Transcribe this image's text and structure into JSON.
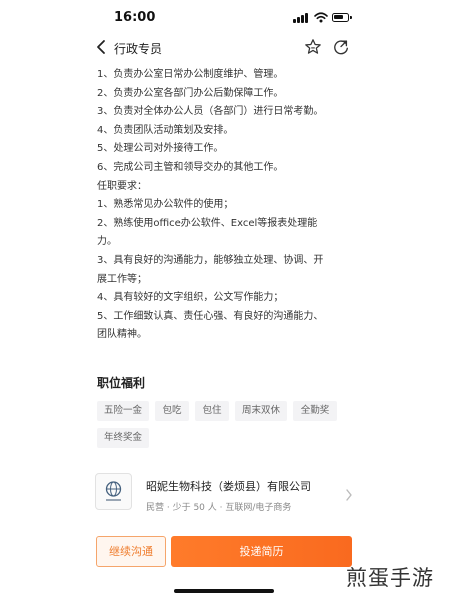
{
  "status_bar": {
    "time": "16:00"
  },
  "nav": {
    "title": "行政专员",
    "back_icon": "chevron-left-icon",
    "favorite_icon": "star-icon",
    "share_icon": "share-icon"
  },
  "description": {
    "lines": [
      "1、负责办公室日常办公制度维护、管理。",
      "2、负责办公室各部门办公后勤保障工作。",
      "3、负责对全体办公人员（各部门）进行日常考勤。",
      "4、负责团队活动策划及安排。",
      "5、处理公司对外接待工作。",
      "6、完成公司主管和领导交办的其他工作。",
      "任职要求：",
      "1、熟悉常见办公软件的使用；",
      "2、熟练使用office办公软件、Excel等报表处理能",
      "力。",
      "3、具有良好的沟通能力，能够独立处理、协调、开",
      "展工作等；",
      "4、具有较好的文字组织，公文写作能力；",
      "5、工作细致认真、责任心强、有良好的沟通能力、",
      "团队精神。"
    ]
  },
  "benefits": {
    "title": "职位福利",
    "tags": [
      "五险一金",
      "包吃",
      "包住",
      "周末双休",
      "全勤奖",
      "年终奖金"
    ]
  },
  "company": {
    "name": "昭妮生物科技（娄烦县）有限公司",
    "meta": "民营 · 少于 50 人 · 互联网/电子商务",
    "logo_icon": "globe-logo-icon",
    "arrow_icon": "chevron-right-icon"
  },
  "actions": {
    "continue_label": "继续沟通",
    "submit_label": "投递简历"
  },
  "watermark": {
    "text": "煎蛋手游"
  },
  "colors": {
    "accent": "#f96a1f",
    "accent_light": "#fff6ef",
    "text": "#333333",
    "muted": "#888888",
    "tag_bg": "#f3f3f5"
  }
}
